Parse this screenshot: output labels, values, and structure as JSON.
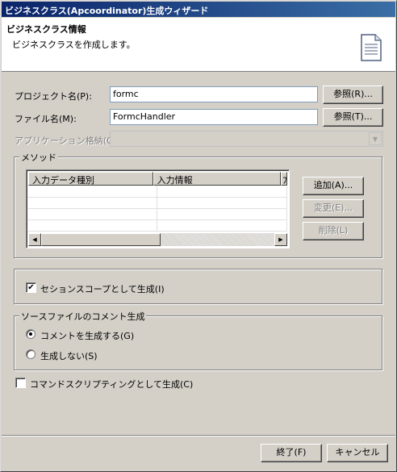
{
  "window": {
    "title": "ビジネスクラス(Apcoordinator)生成ウィザード"
  },
  "header": {
    "title": "ビジネスクラス情報",
    "description": "ビジネスクラスを作成します。",
    "icon": "document-icon"
  },
  "form": {
    "project_label": "プロジェクト名(P):",
    "project_value": "formc",
    "project_browse": "参照(R)...",
    "file_label": "ファイル名(M):",
    "file_value": "FormcHandler",
    "file_browse": "参照(T)...",
    "app_store_label": "アプリケーション格納(O):",
    "app_store_value": ""
  },
  "method_group": {
    "title": "メソッド",
    "columns": [
      "入力データ種別",
      "入力情報",
      "ﾌ"
    ],
    "rows": [],
    "add_button": "追加(A)...",
    "change_button": "変更(E)...",
    "delete_button": "削除(L)"
  },
  "session_scope": {
    "label": "セションスコープとして生成(I)",
    "checked": true
  },
  "comment_group": {
    "title": "ソースファイルのコメント生成",
    "option_generate": "コメントを生成する(G)",
    "option_none": "生成しない(S)",
    "selected": "generate"
  },
  "command_scripting": {
    "label": "コマンドスクリプティングとして生成(C)",
    "checked": false
  },
  "footer": {
    "finish_button": "終了(F)",
    "cancel_button": "キャンセル"
  }
}
